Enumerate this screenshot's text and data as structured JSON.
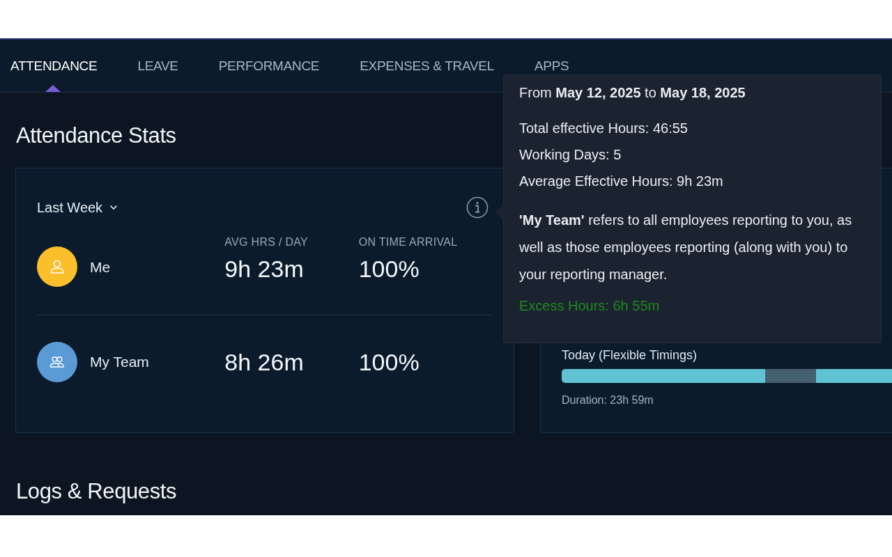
{
  "tabs": [
    {
      "label": "ATTENDANCE",
      "selected": true
    },
    {
      "label": "LEAVE",
      "selected": false
    },
    {
      "label": "PERFORMANCE",
      "selected": false
    },
    {
      "label": "EXPENSES & TRAVEL",
      "selected": false
    },
    {
      "label": "APPS",
      "selected": false
    }
  ],
  "stats": {
    "title": "Attendance Stats",
    "period": "Last Week",
    "columns": [
      "AVG HRS / DAY",
      "ON TIME ARRIVAL"
    ],
    "rows": [
      {
        "name": "Me",
        "kind": "person",
        "color": "#fbbf2c",
        "values": [
          "9h 23m",
          "100%"
        ]
      },
      {
        "name": "My Team",
        "kind": "team",
        "color": "#5b9bd5",
        "values": [
          "8h 26m",
          "100%"
        ]
      }
    ]
  },
  "timings": {
    "title": "Today (Flexible Timings)",
    "duration": "Duration: 23h 59m"
  },
  "tooltip": {
    "range": "From **May 12, 2025** to **May 18, 2025**",
    "lines": [
      "Total effective Hours: 46:55",
      "Working Days: 5",
      "Average Effective Hours: 9h 23m"
    ],
    "note": "**'My Team'** refers to all employees reporting to you, as well as those employees reporting (along with you) to your reporting manager.",
    "excess": "Excess Hours: 6h 55m"
  },
  "logs": {
    "title": "Logs & Requests"
  }
}
